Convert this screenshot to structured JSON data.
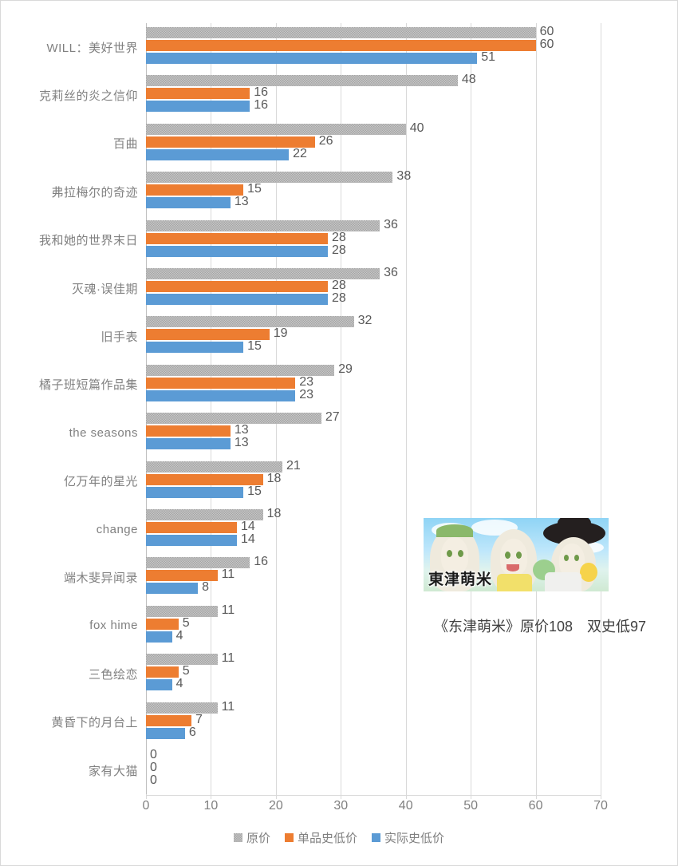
{
  "chart_data": {
    "type": "bar",
    "orientation": "horizontal",
    "title": "",
    "xlabel": "",
    "ylabel": "",
    "xlim": [
      0,
      70
    ],
    "xticks": [
      0,
      10,
      20,
      30,
      40,
      50,
      60,
      70
    ],
    "grid": true,
    "legend_position": "bottom",
    "categories": [
      "WILL：美好世界",
      "克莉丝的炎之信仰",
      "百曲",
      "弗拉梅尔的奇迹",
      "我和她的世界末日",
      "灭魂·误佳期",
      "旧手表",
      "橘子班短篇作品集",
      "the seasons",
      "亿万年的星光",
      "change",
      "端木斐异闻录",
      "fox hime",
      "三色绘恋",
      "黄昏下的月台上",
      "家有大猫"
    ],
    "series": [
      {
        "name": "原价",
        "color": "#a5a5a5",
        "values": [
          60,
          48,
          40,
          38,
          36,
          36,
          32,
          29,
          27,
          21,
          18,
          16,
          11,
          11,
          11,
          0
        ]
      },
      {
        "name": "单品史低价",
        "color": "#ed7d31",
        "values": [
          60,
          16,
          26,
          15,
          28,
          28,
          19,
          23,
          13,
          18,
          14,
          11,
          5,
          5,
          7,
          0
        ]
      },
      {
        "name": "实际史低价",
        "color": "#5b9bd5",
        "values": [
          51,
          16,
          22,
          13,
          28,
          28,
          15,
          23,
          13,
          15,
          14,
          8,
          4,
          4,
          6,
          0
        ]
      }
    ]
  },
  "legend": {
    "items": [
      {
        "label": "原价",
        "color": "#a5a5a5"
      },
      {
        "label": "单品史低价",
        "color": "#ed7d31"
      },
      {
        "label": "实际史低价",
        "color": "#5b9bd5"
      }
    ]
  },
  "promo": {
    "image_alt": "东津萌米",
    "logo_text": "東津萌米",
    "caption": "《东津萌米》原价108　双史低97"
  }
}
